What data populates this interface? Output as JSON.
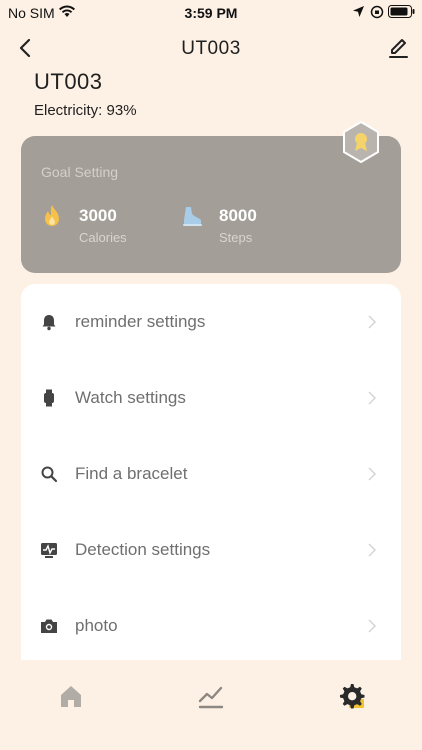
{
  "status_bar": {
    "carrier": "No SIM",
    "time": "3:59 PM",
    "icons": [
      "wifi-icon",
      "location-arrow-icon",
      "orientation-lock-icon",
      "battery-icon"
    ]
  },
  "nav": {
    "title": "UT003",
    "back_icon": "chevron-left-icon",
    "edit_icon": "pencil-icon"
  },
  "device": {
    "name": "UT003",
    "electricity": "Electricity: 93%"
  },
  "goal": {
    "heading": "Goal Setting",
    "calories": {
      "value": "3000",
      "label": "Calories",
      "icon": "flame-icon",
      "color": "#f5c14a"
    },
    "steps": {
      "value": "8000",
      "label": "Steps",
      "icon": "shoe-icon",
      "color": "#a9cde8"
    },
    "medal_icon": "medal-icon",
    "card_color": "#a39e97"
  },
  "menu": {
    "items": [
      {
        "label": "reminder settings",
        "icon": "bell-icon"
      },
      {
        "label": "Watch settings",
        "icon": "watch-icon"
      },
      {
        "label": "Find a bracelet",
        "icon": "search-icon"
      },
      {
        "label": "Detection settings",
        "icon": "monitor-pulse-icon"
      },
      {
        "label": "photo",
        "icon": "camera-icon"
      }
    ]
  },
  "tabs": {
    "items": [
      {
        "name": "home",
        "icon": "home-icon"
      },
      {
        "name": "stats",
        "icon": "chart-line-icon"
      },
      {
        "name": "settings",
        "icon": "gear-icon",
        "active": true
      }
    ],
    "active_color": "#f2c230"
  },
  "colors": {
    "background": "#fdf1e5",
    "accent": "#f2c230"
  }
}
